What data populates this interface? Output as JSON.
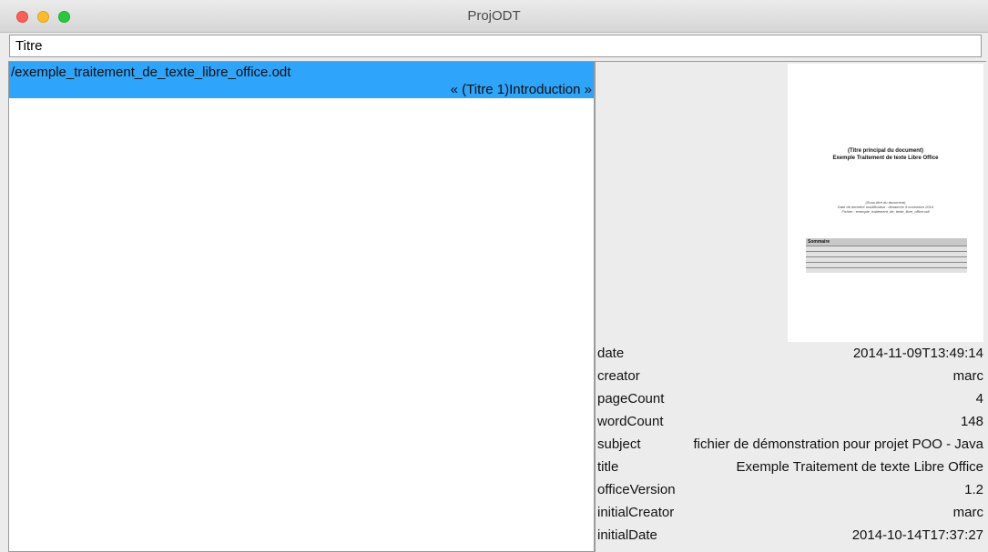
{
  "window": {
    "title": "ProjODT"
  },
  "search": {
    "value": "Titre"
  },
  "results": [
    {
      "path": "/exemple_traitement_de_texte_libre_office.odt",
      "section": "« (Titre 1)Introduction »"
    }
  ],
  "preview": {
    "title_line1": "(Titre principal du document)",
    "title_line2": "Exemple Traitement de texte Libre Office",
    "subtitle_line1": "(Sous-titre du document)",
    "subtitle_line2": "Date de dernière modification : dimanche 9 novembre 2014",
    "subtitle_line3": "Fichier : exemple_traitement_de_texte_libre_office.odt",
    "toc_heading": "Sommaire"
  },
  "metadata": [
    {
      "key": "date",
      "value": "2014-11-09T13:49:14"
    },
    {
      "key": "creator",
      "value": "marc"
    },
    {
      "key": "pageCount",
      "value": "4"
    },
    {
      "key": "wordCount",
      "value": "148"
    },
    {
      "key": "subject",
      "value": "fichier de démonstration pour projet POO - Java"
    },
    {
      "key": "title",
      "value": "Exemple Traitement de texte Libre Office"
    },
    {
      "key": "officeVersion",
      "value": "1.2"
    },
    {
      "key": "initialCreator",
      "value": "marc"
    },
    {
      "key": "initialDate",
      "value": "2014-10-14T17:37:27"
    }
  ],
  "colors": {
    "selection": "#2fa4fb",
    "close": "#fc5f57",
    "minimize": "#fdbc2e",
    "zoom": "#2ac841"
  }
}
